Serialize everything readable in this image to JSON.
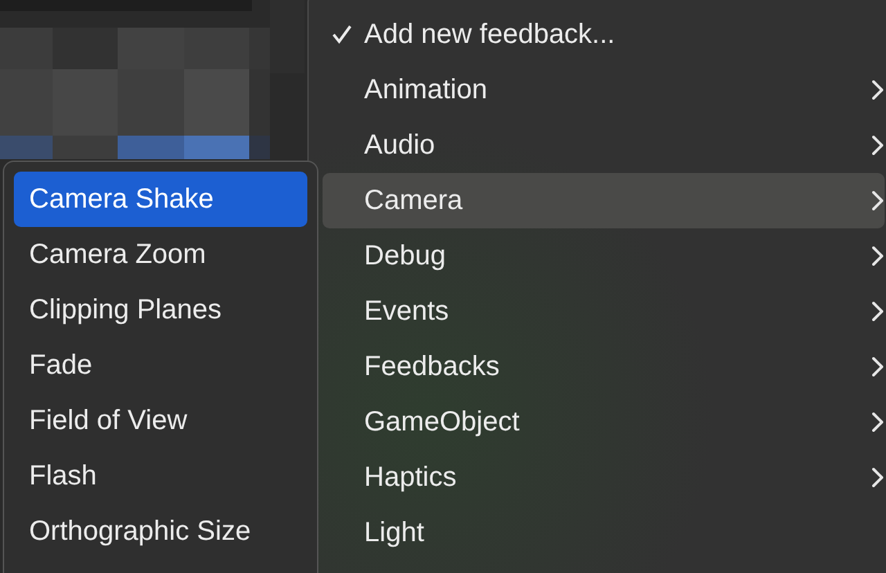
{
  "menu": {
    "items": [
      {
        "label": "Add new feedback...",
        "checked": true,
        "has_submenu": false,
        "selected": false
      },
      {
        "label": "Animation",
        "checked": false,
        "has_submenu": true,
        "selected": false
      },
      {
        "label": "Audio",
        "checked": false,
        "has_submenu": true,
        "selected": false
      },
      {
        "label": "Camera",
        "checked": false,
        "has_submenu": true,
        "selected": true
      },
      {
        "label": "Debug",
        "checked": false,
        "has_submenu": true,
        "selected": false
      },
      {
        "label": "Events",
        "checked": false,
        "has_submenu": true,
        "selected": false
      },
      {
        "label": "Feedbacks",
        "checked": false,
        "has_submenu": true,
        "selected": false
      },
      {
        "label": "GameObject",
        "checked": false,
        "has_submenu": true,
        "selected": false
      },
      {
        "label": "Haptics",
        "checked": false,
        "has_submenu": true,
        "selected": false
      },
      {
        "label": "Light",
        "checked": false,
        "has_submenu": false,
        "selected": false
      }
    ]
  },
  "submenu": {
    "items": [
      {
        "label": "Camera Shake",
        "selected": true
      },
      {
        "label": "Camera Zoom",
        "selected": false
      },
      {
        "label": "Clipping Planes",
        "selected": false
      },
      {
        "label": "Fade",
        "selected": false
      },
      {
        "label": "Field of View",
        "selected": false
      },
      {
        "label": "Flash",
        "selected": false
      },
      {
        "label": "Orthographic Size",
        "selected": false
      }
    ]
  }
}
